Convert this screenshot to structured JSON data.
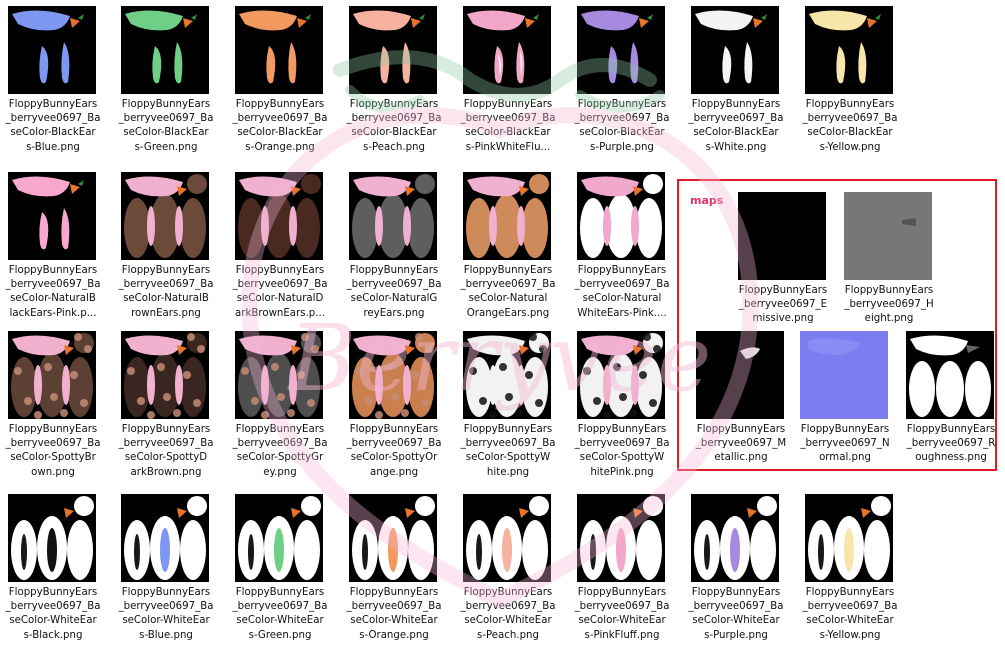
{
  "files": [
    {
      "name": "FloppyBunnyEars_berryvee0697_BaseColor-BlackEars-Blue.png",
      "lines": [
        "FloppyBunnyEars",
        "_berryvee0697_Ba",
        "seColor-BlackEar",
        "s-Blue.png"
      ],
      "style": "black",
      "ear": "#7e97f0",
      "inner": ""
    },
    {
      "name": "FloppyBunnyEars_berryvee0697_BaseColor-BlackEars-Green.png",
      "lines": [
        "FloppyBunnyEars",
        "_berryvee0697_Ba",
        "seColor-BlackEar",
        "s-Green.png"
      ],
      "style": "black",
      "ear": "#6fcf87",
      "inner": ""
    },
    {
      "name": "FloppyBunnyEars_berryvee0697_BaseColor-BlackEars-Orange.png",
      "lines": [
        "FloppyBunnyEars",
        "_berryvee0697_Ba",
        "seColor-BlackEar",
        "s-Orange.png"
      ],
      "style": "black",
      "ear": "#f1995e",
      "inner": ""
    },
    {
      "name": "FloppyBunnyEars_berryvee0697_BaseColor-BlackEars-Peach.png",
      "lines": [
        "FloppyBunnyEars",
        "_berryvee0697_Ba",
        "seColor-BlackEar",
        "s-Peach.png"
      ],
      "style": "black",
      "ear": "#f7b29f",
      "inner": ""
    },
    {
      "name": "FloppyBunnyEars_berryvee0697_BaseColor-BlackEars-PinkWhiteFluff.png",
      "lines": [
        "FloppyBunnyEars",
        "_berryvee0697_Ba",
        "seColor-BlackEar",
        "s-PinkWhiteFlu..."
      ],
      "style": "black",
      "ear": "#f2a6c8",
      "inner": "#ffffff"
    },
    {
      "name": "FloppyBunnyEars_berryvee0697_BaseColor-BlackEars-Purple.png",
      "lines": [
        "FloppyBunnyEars",
        "_berryvee0697_Ba",
        "seColor-BlackEar",
        "s-Purple.png"
      ],
      "style": "black",
      "ear": "#a68ae0",
      "inner": ""
    },
    {
      "name": "FloppyBunnyEars_berryvee0697_BaseColor-BlackEars-White.png",
      "lines": [
        "FloppyBunnyEars",
        "_berryvee0697_Ba",
        "seColor-BlackEar",
        "s-White.png"
      ],
      "style": "black",
      "ear": "#f4f4f4",
      "inner": ""
    },
    {
      "name": "FloppyBunnyEars_berryvee0697_BaseColor-BlackEars-Yellow.png",
      "lines": [
        "FloppyBunnyEars",
        "_berryvee0697_Ba",
        "seColor-BlackEar",
        "s-Yellow.png"
      ],
      "style": "black",
      "ear": "#f6e6aa",
      "inner": ""
    },
    {
      "name": "FloppyBunnyEars_berryvee0697_BaseColor-NaturalBlackEars-Pink.png",
      "lines": [
        "FloppyBunnyEars",
        "_berryvee0697_Ba",
        "seColor-NaturalB",
        "lackEars-Pink.p..."
      ],
      "style": "black",
      "ear": "#f7a8cc",
      "inner": ""
    },
    {
      "name": "FloppyBunnyEars_berryvee0697_BaseColor-NaturalBrownEars.png",
      "lines": [
        "FloppyBunnyEars",
        "_berryvee0697_Ba",
        "seColor-NaturalB",
        "rownEars.png"
      ],
      "style": "fill",
      "ear": "#6b4a3a",
      "inner": "#f0b0cf"
    },
    {
      "name": "FloppyBunnyEars_berryvee0697_BaseColor-NaturalDarkBrownEars.png",
      "lines": [
        "FloppyBunnyEars",
        "_berryvee0697_Ba",
        "seColor-NaturalD",
        "arkBrownEars.p..."
      ],
      "style": "fill",
      "ear": "#4a2a20",
      "inner": "#f0b0cf"
    },
    {
      "name": "FloppyBunnyEars_berryvee0697_BaseColor-NaturalGreyEars.png",
      "lines": [
        "FloppyBunnyEars",
        "_berryvee0697_Ba",
        "seColor-NaturalG",
        "reyEars.png"
      ],
      "style": "fill",
      "ear": "#5e5e5e",
      "inner": "#f0b0cf"
    },
    {
      "name": "FloppyBunnyEars_berryvee0697_BaseColor-NaturalOrangeEars.png",
      "lines": [
        "FloppyBunnyEars",
        "_berryvee0697_Ba",
        "seColor-Natural",
        "OrangeEars.png"
      ],
      "style": "fill",
      "ear": "#cf8a5c",
      "inner": "#f0b0cf"
    },
    {
      "name": "FloppyBunnyEars_berryvee0697_BaseColor-NaturalWhiteEars-Pink.png",
      "lines": [
        "FloppyBunnyEars",
        "_berryvee0697_Ba",
        "seColor-Natural",
        "WhiteEars-Pink...."
      ],
      "style": "fill",
      "ear": "#ffffff",
      "inner": "#f0a8cc"
    },
    {
      "name": "FloppyBunnyEars_berryvee0697_BaseColor-SpottyBrown.png",
      "lines": [
        "FloppyBunnyEars",
        "_berryvee0697_Ba",
        "seColor-SpottyBr",
        "own.png"
      ],
      "style": "spotty",
      "ear": "#5c4034",
      "inner": "#f2b0cf"
    },
    {
      "name": "FloppyBunnyEars_berryvee0697_BaseColor-SpottyDarkBrown.png",
      "lines": [
        "FloppyBunnyEars",
        "_berryvee0697_Ba",
        "seColor-SpottyD",
        "arkBrown.png"
      ],
      "style": "spotty",
      "ear": "#3a2620",
      "inner": "#f2b0cf"
    },
    {
      "name": "FloppyBunnyEars_berryvee0697_BaseColor-SpottyGrey.png",
      "lines": [
        "FloppyBunnyEars",
        "_berryvee0697_Ba",
        "seColor-SpottyGr",
        "ey.png"
      ],
      "style": "spotty",
      "ear": "#4e4e4e",
      "inner": "#f2b0cf"
    },
    {
      "name": "FloppyBunnyEars_berryvee0697_BaseColor-SpottyOrange.png",
      "lines": [
        "FloppyBunnyEars",
        "_berryvee0697_Ba",
        "seColor-SpottyOr",
        "ange.png"
      ],
      "style": "spotty",
      "ear": "#c9804e",
      "inner": "#f2b0cf"
    },
    {
      "name": "FloppyBunnyEars_berryvee0697_BaseColor-SpottyWhite.png",
      "lines": [
        "FloppyBunnyEars",
        "_berryvee0697_Ba",
        "seColor-SpottyW",
        "hite.png"
      ],
      "style": "spotty",
      "ear": "#f2f2f2",
      "inner": "#f2f2f2"
    },
    {
      "name": "FloppyBunnyEars_berryvee0697_BaseColor-SpottyWhitePink.png",
      "lines": [
        "FloppyBunnyEars",
        "_berryvee0697_Ba",
        "seColor-SpottyW",
        "hitePink.png"
      ],
      "style": "spotty",
      "ear": "#f2f2f2",
      "inner": "#f2b0cf"
    },
    {
      "name": "FloppyBunnyEars_berryvee0697_BaseColor-WhiteEars-Black.png",
      "lines": [
        "FloppyBunnyEars",
        "_berryvee0697_Ba",
        "seColor-WhiteEar",
        "s-Black.png"
      ],
      "style": "white",
      "ear": "#ffffff",
      "inner": "#111111"
    },
    {
      "name": "FloppyBunnyEars_berryvee0697_BaseColor-WhiteEars-Blue.png",
      "lines": [
        "FloppyBunnyEars",
        "_berryvee0697_Ba",
        "seColor-WhiteEar",
        "s-Blue.png"
      ],
      "style": "white",
      "ear": "#ffffff",
      "inner": "#7e97f0"
    },
    {
      "name": "FloppyBunnyEars_berryvee0697_BaseColor-WhiteEars-Green.png",
      "lines": [
        "FloppyBunnyEars",
        "_berryvee0697_Ba",
        "seColor-WhiteEar",
        "s-Green.png"
      ],
      "style": "white",
      "ear": "#ffffff",
      "inner": "#6fcf87"
    },
    {
      "name": "FloppyBunnyEars_berryvee0697_BaseColor-WhiteEars-Orange.png",
      "lines": [
        "FloppyBunnyEars",
        "_berryvee0697_Ba",
        "seColor-WhiteEar",
        "s-Orange.png"
      ],
      "style": "white",
      "ear": "#ffffff",
      "inner": "#f1995e"
    },
    {
      "name": "FloppyBunnyEars_berryvee0697_BaseColor-WhiteEars-Peach.png",
      "lines": [
        "FloppyBunnyEars",
        "_berryvee0697_Ba",
        "seColor-WhiteEar",
        "s-Peach.png"
      ],
      "style": "white",
      "ear": "#ffffff",
      "inner": "#f7b29f"
    },
    {
      "name": "FloppyBunnyEars_berryvee0697_BaseColor-WhiteEars-PinkFluff.png",
      "lines": [
        "FloppyBunnyEars",
        "_berryvee0697_Ba",
        "seColor-WhiteEar",
        "s-PinkFluff.png"
      ],
      "style": "white",
      "ear": "#ffffff",
      "inner": "#f2a6c8"
    },
    {
      "name": "FloppyBunnyEars_berryvee0697_BaseColor-WhiteEars-Purple.png",
      "lines": [
        "FloppyBunnyEars",
        "_berryvee0697_Ba",
        "seColor-WhiteEar",
        "s-Purple.png"
      ],
      "style": "white",
      "ear": "#ffffff",
      "inner": "#a68ae0"
    },
    {
      "name": "FloppyBunnyEars_berryvee0697_BaseColor-WhiteEars-Yellow.png",
      "lines": [
        "FloppyBunnyEars",
        "_berryvee0697_Ba",
        "seColor-WhiteEar",
        "s-Yellow.png"
      ],
      "style": "white",
      "ear": "#ffffff",
      "inner": "#f6e6aa"
    }
  ],
  "maps": {
    "label": "maps",
    "border_color": "#e01b24",
    "files": [
      {
        "name": "FloppyBunnyEars_berryvee0697_Emissive.png",
        "lines": [
          "FloppyBunnyEars",
          "_berryvee0697_E",
          "missive.png"
        ],
        "style": "emissive"
      },
      {
        "name": "FloppyBunnyEars_berryvee0697_Height.png",
        "lines": [
          "FloppyBunnyEars",
          "_berryvee0697_H",
          "eight.png"
        ],
        "style": "height"
      },
      {
        "name": "FloppyBunnyEars_berryvee0697_Metallic.png",
        "lines": [
          "FloppyBunnyEars",
          "_berryvee0697_M",
          "etallic.png"
        ],
        "style": "metallic"
      },
      {
        "name": "FloppyBunnyEars_berryvee0697_Normal.png",
        "lines": [
          "FloppyBunnyEars",
          "_berryvee0697_N",
          "ormal.png"
        ],
        "style": "normal"
      },
      {
        "name": "FloppyBunnyEars_berryvee0697_Roughness.png",
        "lines": [
          "FloppyBunnyEars",
          "_berryvee0697_R",
          "oughness.png"
        ],
        "style": "roughness"
      }
    ]
  },
  "watermark": {
    "text": "Berryvee",
    "color": "#f4b8d6",
    "leaf_color": "#8fc9a6"
  },
  "colors": {
    "carrot": "#e8742a",
    "carrot_leaf": "#2e8b3a"
  }
}
